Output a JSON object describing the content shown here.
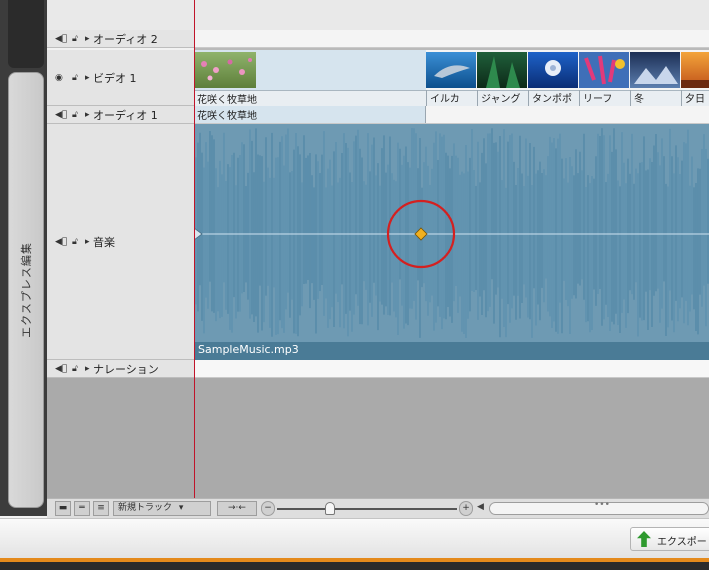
{
  "side_tab": {
    "label": "エクスプレス編集"
  },
  "tracks": [
    {
      "name": "オーディオ 2"
    },
    {
      "name": "ビデオ 1"
    },
    {
      "name": "オーディオ 1"
    },
    {
      "name": "音楽"
    },
    {
      "name": "ナレーション"
    }
  ],
  "video_clips": [
    "花咲く牧草地",
    "イルカ",
    "ジャング",
    "タンポポ",
    "リーフ",
    "冬",
    "夕日"
  ],
  "audio1_clip": "花咲く牧草地",
  "music_clip": "SampleMusic.mp3",
  "toolbar": {
    "new_track": "新規トラック"
  },
  "status": {
    "export_label": "エクスポー"
  },
  "colors": {
    "playhead": "#c0142a",
    "waveform": "#4f86a6",
    "keyframe": "#f0b020",
    "annotation_circle": "#d42020",
    "accent_orange": "#e48a1c"
  }
}
